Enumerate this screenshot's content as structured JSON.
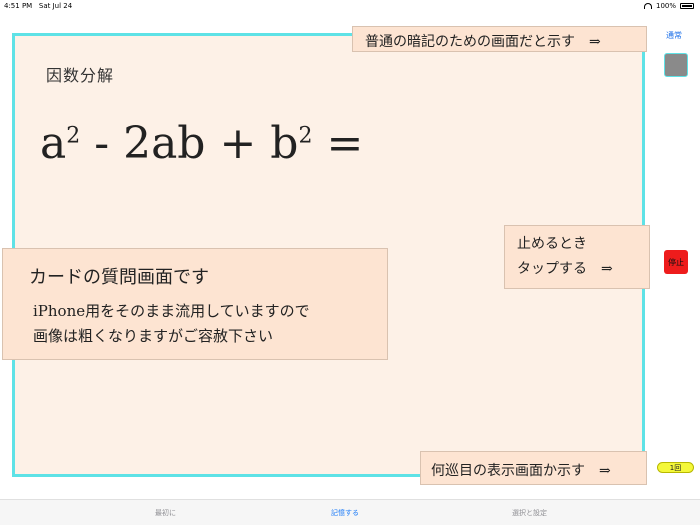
{
  "status": {
    "time": "4:51 PM",
    "date": "Sat Jul 24",
    "battery": "100%"
  },
  "card": {
    "title": "因数分解",
    "formula": {
      "a": "a",
      "exp1": "2",
      "mid": " -  2ab + b",
      "exp2": "2",
      "eq": " ="
    }
  },
  "notes": {
    "top": "普通の暗記のための画面だと示す　⇒",
    "stop_line1": "止めるとき",
    "stop_line2": "タップする　⇒",
    "count": "何巡目の表示画面か示す　⇒",
    "main_head": "カードの質問画面です",
    "main_body": "iPhone用をそのまま流用していますので\n画像は粗くなりますがご容赦下さい"
  },
  "sidebar": {
    "mode_label": "通常",
    "stop_label": "停止",
    "count_label": "1回"
  },
  "tabs": [
    {
      "label": "最初に"
    },
    {
      "label": "記憶する"
    },
    {
      "label": "選択と設定"
    }
  ],
  "colors": {
    "accent": "#1a7af8",
    "card_border": "#5ee2e6",
    "stop": "#ee1c1c",
    "counter": "#f4f83a"
  }
}
